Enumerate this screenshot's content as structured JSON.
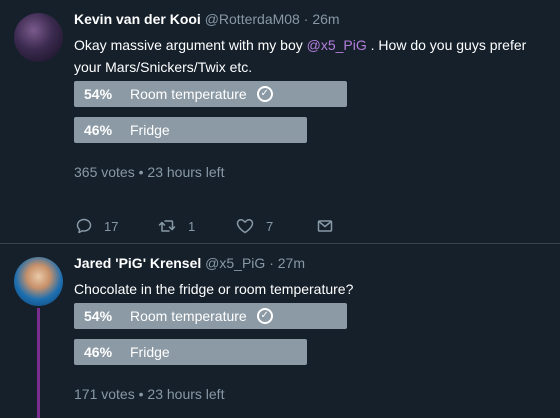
{
  "tweets": [
    {
      "name": "Kevin van der Kooi",
      "handle": "@RotterdaM08",
      "time": "26m",
      "text_before": "Okay massive argument with my boy ",
      "mention": "@x5_PiG",
      "text_after": " . How do you guys prefer your Mars/Snickers/Twix etc.",
      "poll": [
        {
          "percent": "54%",
          "label": "Room temperature",
          "selected": true,
          "share": 0.54
        },
        {
          "percent": "46%",
          "label": "Fridge",
          "selected": false,
          "share": 0.46
        }
      ],
      "votes": "365 votes",
      "time_left": "23 hours left",
      "actions": {
        "replies": "17",
        "retweets": "1",
        "likes": "7"
      }
    },
    {
      "name": "Jared 'PiG' Krensel",
      "handle": "@x5_PiG",
      "time": "27m",
      "text": "Chocolate in the fridge or room temperature?",
      "poll": [
        {
          "percent": "54%",
          "label": "Room temperature",
          "selected": true,
          "share": 0.54
        },
        {
          "percent": "46%",
          "label": "Fridge",
          "selected": false,
          "share": 0.46
        }
      ],
      "votes": "171 votes",
      "time_left": "23 hours left"
    }
  ],
  "colors": {
    "background": "#15202b",
    "poll_bar": "#8b9aa5",
    "mention": "#b57edc",
    "muted": "#8899a6",
    "thread_line": "#7b2d8f"
  },
  "icons": [
    "reply-icon",
    "retweet-icon",
    "like-icon",
    "message-icon",
    "check-circle-icon"
  ]
}
